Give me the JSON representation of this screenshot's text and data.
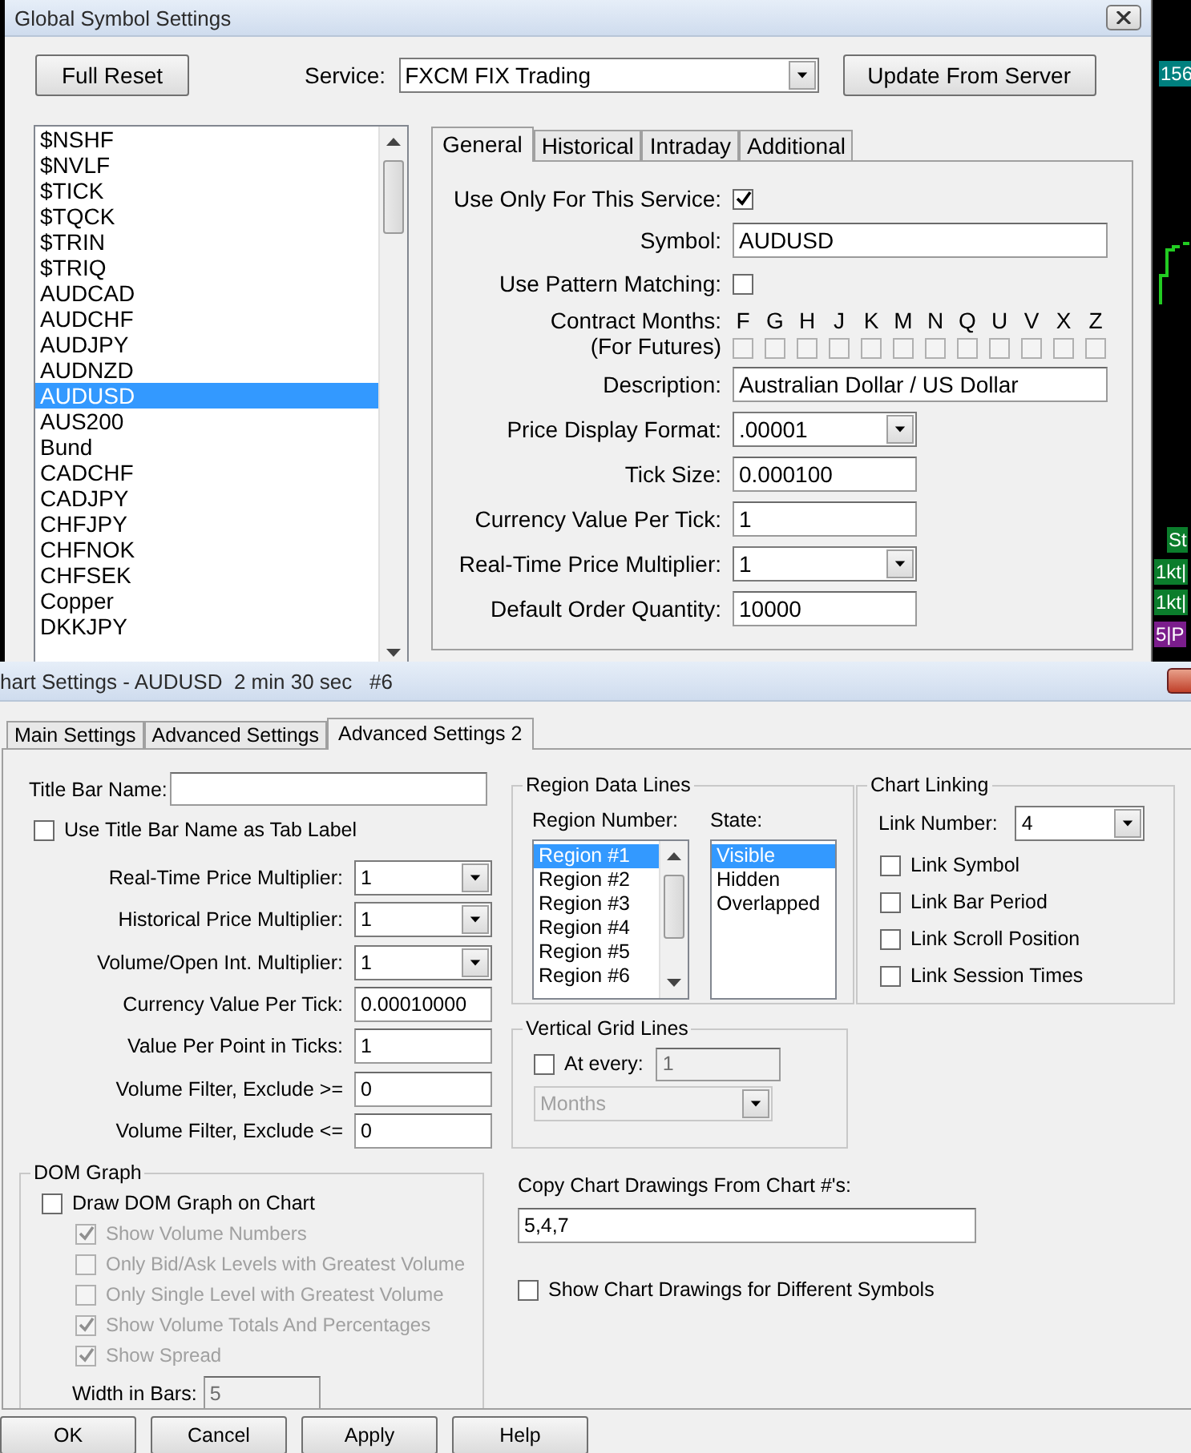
{
  "background": {
    "labels": [
      {
        "text": "156",
        "color": "#00807f"
      },
      {
        "text": "St",
        "color": "#0b7d2c"
      },
      {
        "text": "1kt|",
        "color": "#0b7d2c"
      },
      {
        "text": "1kt|",
        "color": "#0b7d2c"
      },
      {
        "text": "5|P",
        "color": "#7b1d8c"
      }
    ]
  },
  "symbol_window": {
    "title": "Global Symbol Settings",
    "full_reset": "Full Reset",
    "service": {
      "label": "Service:",
      "value": "FXCM FIX Trading"
    },
    "update": "Update From Server",
    "symbols": [
      {
        "name": "$NSHF",
        "selected": false
      },
      {
        "name": "$NVLF",
        "selected": false
      },
      {
        "name": "$TICK",
        "selected": false
      },
      {
        "name": "$TQCK",
        "selected": false
      },
      {
        "name": "$TRIN",
        "selected": false
      },
      {
        "name": "$TRIQ",
        "selected": false
      },
      {
        "name": "AUDCAD",
        "selected": false
      },
      {
        "name": "AUDCHF",
        "selected": false
      },
      {
        "name": "AUDJPY",
        "selected": false
      },
      {
        "name": "AUDNZD",
        "selected": false
      },
      {
        "name": "AUDUSD",
        "selected": true
      },
      {
        "name": "AUS200",
        "selected": false
      },
      {
        "name": "Bund",
        "selected": false
      },
      {
        "name": "CADCHF",
        "selected": false
      },
      {
        "name": "CADJPY",
        "selected": false
      },
      {
        "name": "CHFJPY",
        "selected": false
      },
      {
        "name": "CHFNOK",
        "selected": false
      },
      {
        "name": "CHFSEK",
        "selected": false
      },
      {
        "name": "Copper",
        "selected": false
      },
      {
        "name": "DKKJPY",
        "selected": false
      }
    ],
    "tabs": [
      {
        "label": "General",
        "selected": true
      },
      {
        "label": "Historical",
        "selected": false
      },
      {
        "label": "Intraday",
        "selected": false
      },
      {
        "label": "Additional",
        "selected": false
      }
    ],
    "rows": [
      {
        "kind": "checkbox",
        "label": "Use Only For This Service:",
        "checked": true
      },
      {
        "kind": "long_field",
        "label": "Symbol:",
        "value": "AUDUSD"
      },
      {
        "kind": "checkbox",
        "label": "Use Pattern Matching:",
        "checked": false
      },
      {
        "kind": "months",
        "label": "Contract Months:",
        "note": "(For Futures)",
        "months": [
          {
            "letter": "F",
            "checked": false
          },
          {
            "letter": "G",
            "checked": false
          },
          {
            "letter": "H",
            "checked": false
          },
          {
            "letter": "J",
            "checked": false
          },
          {
            "letter": "K",
            "checked": false
          },
          {
            "letter": "M",
            "checked": false
          },
          {
            "letter": "N",
            "checked": false
          },
          {
            "letter": "Q",
            "checked": false
          },
          {
            "letter": "U",
            "checked": false
          },
          {
            "letter": "V",
            "checked": false
          },
          {
            "letter": "X",
            "checked": false
          },
          {
            "letter": "Z",
            "checked": false
          }
        ]
      },
      {
        "kind": "long_field",
        "label": "Description:",
        "value": "Australian Dollar / US Dollar"
      },
      {
        "kind": "dropdown",
        "label": "Price Display Format:",
        "value": ".00001"
      },
      {
        "kind": "field",
        "label": "Tick Size:",
        "value": "0.000100"
      },
      {
        "kind": "field",
        "label": "Currency Value Per Tick:",
        "value": "1"
      },
      {
        "kind": "dropdown",
        "label": "Real-Time Price Multiplier:",
        "value": "1"
      },
      {
        "kind": "field",
        "label": "Default Order Quantity:",
        "value": "10000"
      }
    ]
  },
  "chart_window": {
    "title": "hart Settings - AUDUSD  2 min 30 sec   #6",
    "tabs": [
      {
        "label": "Main Settings",
        "selected": false
      },
      {
        "label": "Advanced Settings",
        "selected": false
      },
      {
        "label": "Advanced Settings 2",
        "selected": true
      }
    ],
    "title_bar_name": {
      "label": "Title Bar Name:"
    },
    "tab_label": {
      "label": "Use Title Bar Name as Tab Label",
      "checked": false
    },
    "rows": [
      {
        "kind": "dropdown",
        "label": "Real-Time Price Multiplier:",
        "value": "1"
      },
      {
        "kind": "dropdown",
        "label": "Historical Price Multiplier:",
        "value": "1"
      },
      {
        "kind": "dropdown",
        "label": "Volume/Open Int. Multiplier:",
        "value": "1"
      },
      {
        "kind": "field",
        "label": "Currency Value Per Tick:",
        "value": "0.00010000"
      },
      {
        "kind": "field",
        "label": "Value Per Point in Ticks:",
        "value": "1"
      },
      {
        "kind": "field",
        "label": "Volume Filter, Exclude >=",
        "value": "0"
      },
      {
        "kind": "field",
        "label": "Volume Filter, Exclude <=",
        "value": "0"
      }
    ],
    "dom_graph": {
      "title": "DOM Graph",
      "draw": {
        "label": "Draw DOM Graph on Chart",
        "checked": false
      },
      "options": [
        {
          "label": "Show Volume Numbers",
          "checked": true,
          "disabled": true
        },
        {
          "label": "Only Bid/Ask Levels with Greatest Volume",
          "checked": false,
          "disabled": true
        },
        {
          "label": "Only Single Level with Greatest Volume",
          "checked": false,
          "disabled": true
        },
        {
          "label": "Show Volume Totals And Percentages",
          "checked": true,
          "disabled": true
        },
        {
          "label": "Show Spread",
          "checked": true,
          "disabled": true
        }
      ],
      "width": {
        "label": "Width in Bars:",
        "value": "5",
        "disabled": true
      }
    },
    "region_data_lines": {
      "title": "Region Data Lines",
      "region_label": "Region Number:",
      "regions": [
        {
          "label": "Region #1",
          "selected": true
        },
        {
          "label": "Region #2",
          "selected": false
        },
        {
          "label": "Region #3",
          "selected": false
        },
        {
          "label": "Region #4",
          "selected": false
        },
        {
          "label": "Region #5",
          "selected": false
        },
        {
          "label": "Region #6",
          "selected": false
        }
      ],
      "state_label": "State:",
      "states": [
        {
          "label": "Visible",
          "selected": true
        },
        {
          "label": "Hidden",
          "selected": false
        },
        {
          "label": "Overlapped",
          "selected": false
        }
      ]
    },
    "vertical_grid": {
      "title": "Vertical Grid Lines",
      "at_every": {
        "label": "At every:",
        "checked": false,
        "value": "1"
      },
      "unit": "Months",
      "disabled": true
    },
    "copy_drawings": {
      "label": "Copy Chart Drawings From Chart #'s:",
      "value": "5,4,7"
    },
    "show_drawings": {
      "label": "Show Chart Drawings for Different Symbols",
      "checked": false
    },
    "chart_linking": {
      "title": "Chart Linking",
      "link_number": {
        "label": "Link Number:",
        "value": "4"
      },
      "links": [
        {
          "label": "Link Symbol",
          "checked": false
        },
        {
          "label": "Link Bar Period",
          "checked": false
        },
        {
          "label": "Link Scroll Position",
          "checked": false
        },
        {
          "label": "Link Session Times",
          "checked": false
        }
      ]
    },
    "buttons": [
      "OK",
      "Cancel",
      "Apply",
      "Help"
    ]
  }
}
